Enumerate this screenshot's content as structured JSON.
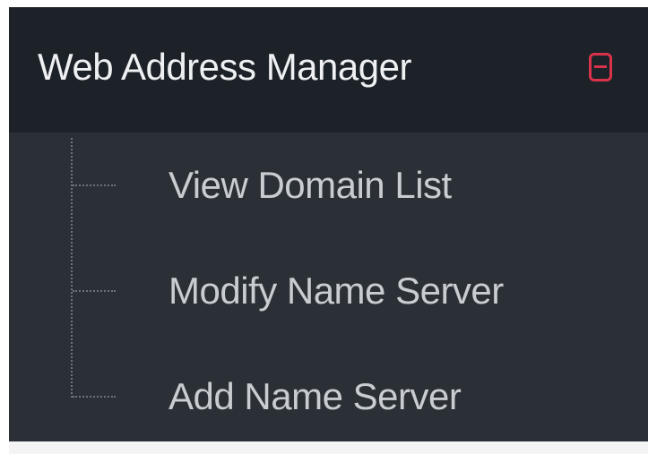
{
  "menu": {
    "title": "Web Address Manager",
    "collapse_icon": "minus-square-icon",
    "accent_color": "#d8334a",
    "items": [
      {
        "label": "View Domain List"
      },
      {
        "label": "Modify Name Server"
      },
      {
        "label": "Add Name Server"
      }
    ]
  }
}
